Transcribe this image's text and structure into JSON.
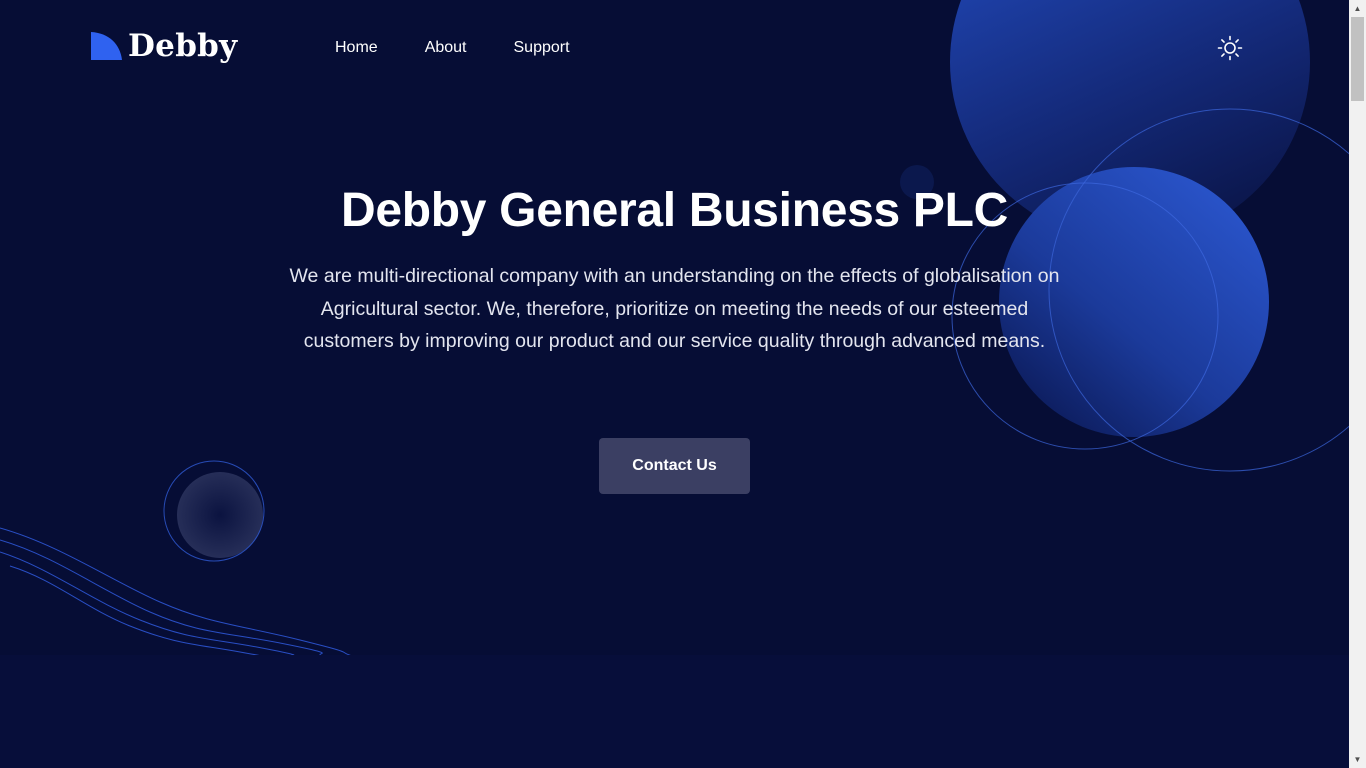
{
  "brand": {
    "name": "Debby",
    "accent_color": "#2f62f0"
  },
  "nav": {
    "items": [
      {
        "label": "Home"
      },
      {
        "label": "About"
      },
      {
        "label": "Support"
      }
    ]
  },
  "theme_toggle": {
    "icon": "sun-icon"
  },
  "hero": {
    "title": "Debby General Business PLC",
    "description": "We are multi-directional company with an understanding on the effects of globalisation on Agricultural sector. We, therefore, prioritize on meeting the needs of our esteemed customers by improving our product and our service quality through advanced means.",
    "cta_label": "Contact Us"
  },
  "colors": {
    "background": "#060d35",
    "cta_background": "#3b3f63",
    "text": "#ffffff"
  }
}
